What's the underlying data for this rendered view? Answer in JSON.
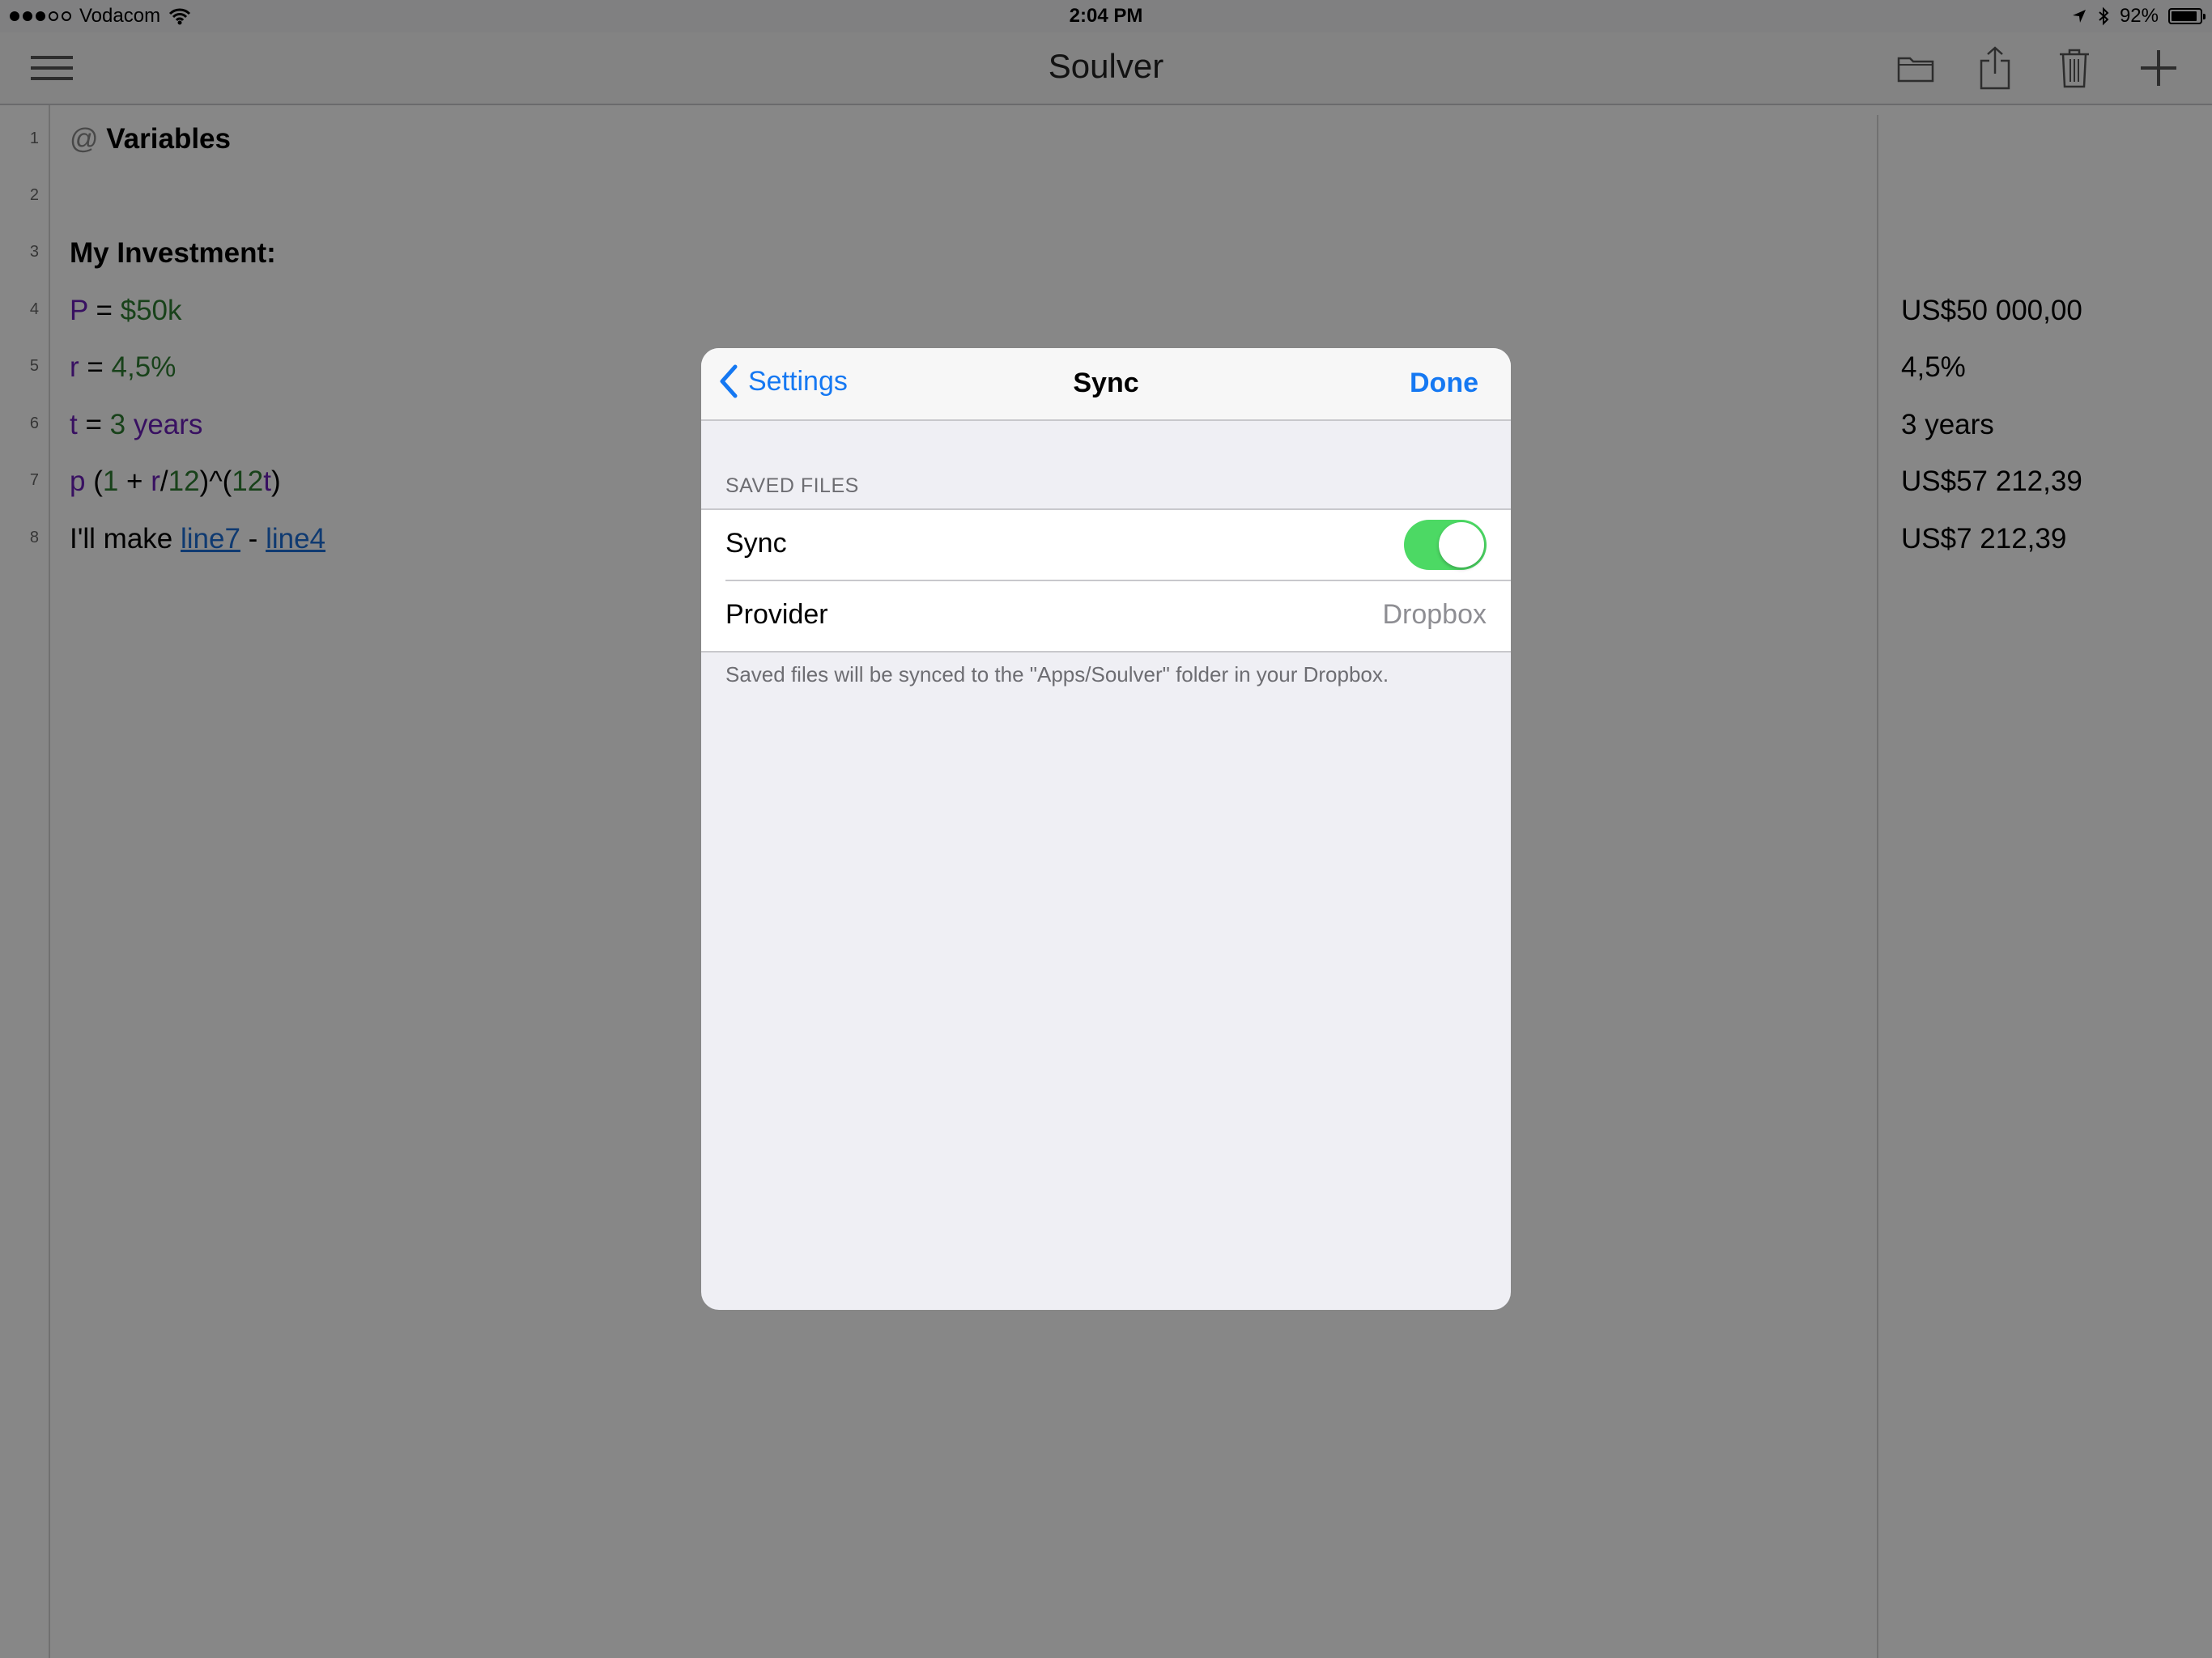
{
  "status_bar": {
    "carrier": "Vodacom",
    "time": "2:04 PM",
    "battery": "92%",
    "battery_level": 0.92,
    "signal_bars_filled": 3,
    "signal_bars_total": 5
  },
  "app": {
    "title": "Soulver",
    "toolbar_icons": [
      "menu-icon",
      "folder-icon",
      "share-icon",
      "trash-icon",
      "add-icon"
    ]
  },
  "editor": {
    "line_numbers": [
      "1",
      "2",
      "3",
      "4",
      "5",
      "6",
      "7",
      "8"
    ],
    "line1": {
      "at": "@",
      "text": "Variables"
    },
    "line3": {
      "text": "My Investment:"
    },
    "line4": {
      "var": "P",
      "eq": " = ",
      "value": "$50k"
    },
    "line5": {
      "var": "r",
      "eq": " = ",
      "value": "4,5%"
    },
    "line6": {
      "var": "t",
      "eq": " = ",
      "num": "3",
      "unit": " years"
    },
    "line7": {
      "p": "p",
      "open": " (",
      "one": "1",
      "plus": " + ",
      "r": "r",
      "slash": "/",
      "twelve": "12",
      "close": ")^(",
      "twelve2": "12",
      "t": "t",
      "end": ")"
    },
    "line8": {
      "prefix": "I'll make ",
      "ref1": "line7",
      "minus": " - ",
      "ref2": "line4"
    },
    "answers": {
      "line4": "US$50 000,00",
      "line5": "4,5%",
      "line6": "3 years",
      "line7": "US$57 212,39",
      "line8": "US$7 212,39"
    }
  },
  "modal": {
    "back_label": "Settings",
    "title": "Sync",
    "done_label": "Done",
    "section_header": "SAVED FILES",
    "sync_label": "Sync",
    "sync_enabled": true,
    "provider_label": "Provider",
    "provider_value": "Dropbox",
    "footer": "Saved files will be synced to the \"Apps/Soulver\" folder in your Dropbox."
  },
  "colors": {
    "accent": "#1578f2",
    "toggle_on": "#4cd964",
    "variable": "#6b1fb8",
    "number": "#2e7d32"
  }
}
